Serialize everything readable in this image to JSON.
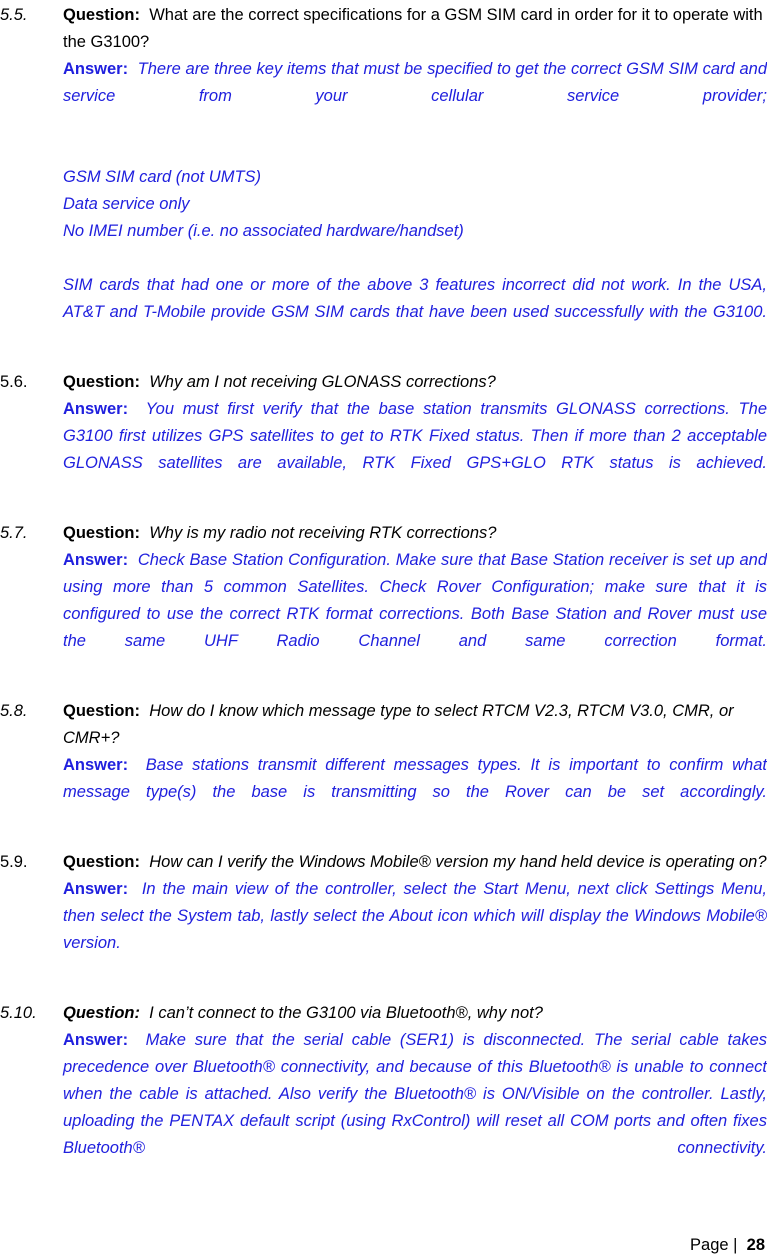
{
  "document": {
    "type": "faq-manual-page",
    "page_number": "28",
    "footer": {
      "label": "Page",
      "separator": "|",
      "number": "28"
    },
    "text_colors": {
      "question": "#000000",
      "answer": "#2020DE"
    }
  },
  "items": [
    {
      "number": "5.5.",
      "number_italic": true,
      "question_label": "Question",
      "question_label_italic": false,
      "question_colon": ":",
      "question_text": "What are the correct specifications for a GSM SIM card in order for it to operate with the G3100?",
      "question_text_italic": false,
      "answer_label": "Answer:",
      "answer_text": "There are three key items that must be specified to get the correct GSM SIM card and service from your cellular service provider;",
      "extra_lines": [
        "GSM SIM card (not UMTS)",
        "Data service only",
        "No IMEI number (i.e. no associated hardware/handset)"
      ],
      "trailing_paragraph": "SIM cards that had one or more of the above 3 features incorrect did not work. In the USA, AT&T and T-Mobile provide GSM SIM cards that have been used successfully with the G3100."
    },
    {
      "number": "5.6.",
      "number_italic": false,
      "question_label": "Question",
      "question_label_italic": false,
      "question_colon": ":",
      "question_text": "Why am I not receiving GLONASS corrections?",
      "question_text_italic": true,
      "answer_label": "Answer:",
      "answer_text": "You must first verify that the base station transmits GLONASS corrections.  The G3100 first utilizes GPS satellites to get to RTK Fixed status.  Then if more than 2 acceptable GLONASS satellites are available, RTK Fixed GPS+GLO RTK status is achieved."
    },
    {
      "number": "5.7.",
      "number_italic": true,
      "question_label": "Question",
      "question_label_italic": false,
      "question_colon": ":",
      "question_text": "Why is my radio not receiving RTK corrections?",
      "question_text_italic": true,
      "answer_label": "Answer:",
      "answer_text": "Check Base Station Configuration.  Make sure that Base Station receiver is set up and using more than 5 common Satellites.  Check Rover Configuration; make sure that it is configured to use the correct RTK format corrections.  Both Base Station and Rover must use the same UHF Radio Channel and same correction format."
    },
    {
      "number": "5.8.",
      "number_italic": true,
      "question_label": "Question",
      "question_label_italic": false,
      "question_colon": ":",
      "question_text": "How do I know which message type to select RTCM V2.3, RTCM V3.0, CMR, or CMR+?",
      "question_text_italic": true,
      "answer_label": "Answer:",
      "answer_text": "Base stations transmit different messages types.  It is important to confirm what message type(s) the base is transmitting so the Rover can be set accordingly."
    },
    {
      "number": "5.9.",
      "number_italic": false,
      "question_label": "Question",
      "question_label_italic": false,
      "question_colon": ":",
      "question_text": "How can I verify the Windows Mobile® version my hand held device is operating on?",
      "question_text_italic": true,
      "answer_label": "Answer:",
      "answer_text": "In the main view of the controller, select the Start Menu, next click Settings Menu, then select the System tab, lastly select the About icon  which will display the Windows Mobile® version."
    },
    {
      "number": "5.10.",
      "number_italic": true,
      "question_label": "Question:",
      "question_label_italic": true,
      "question_colon": "",
      "question_text": "I can’t connect to the G3100 via Bluetooth®, why not?",
      "question_text_italic": true,
      "answer_label": "Answer:",
      "answer_text": "Make sure that the serial cable (SER1) is disconnected.  The serial cable takes precedence over Bluetooth® connectivity, and because of this Bluetooth® is unable to connect when the cable is attached.  Also verify the Bluetooth® is ON/Visible on the controller.  Lastly, uploading the PENTAX default script (using RxControl) will reset all COM ports and often fixes Bluetooth® connectivity."
    }
  ]
}
